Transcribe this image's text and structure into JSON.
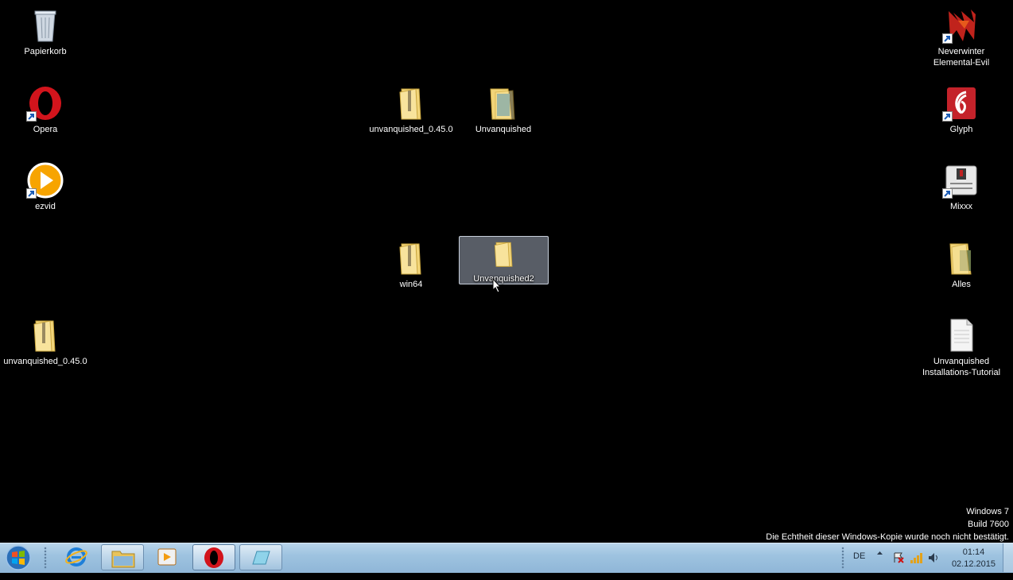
{
  "desktop": {
    "icons": {
      "recycle_bin": "Papierkorb",
      "opera": "Opera",
      "ezvid": "ezvid",
      "unvanquished_left": "unvanquished_0.45.0",
      "unvanquished_center_zip": "unvanquished_0.45.0",
      "unvanquished_folder": "Unvanquished",
      "win64": "win64",
      "unvanquished2": "Unvanquished2",
      "neverwinter": "Neverwinter\nElemental-Evil",
      "glyph": "Glyph",
      "mixxx": "Mixxx",
      "alles": "Alles",
      "tutorial": "Unvanquished\nInstallations-Tutorial"
    }
  },
  "watermark": {
    "line1": "Windows 7",
    "line2": "Build 7600",
    "line3": "Die Echtheit dieser Windows-Kopie wurde noch nicht bestätigt."
  },
  "taskbar": {
    "language": "DE",
    "time": "01:14",
    "date": "02.12.2015"
  }
}
